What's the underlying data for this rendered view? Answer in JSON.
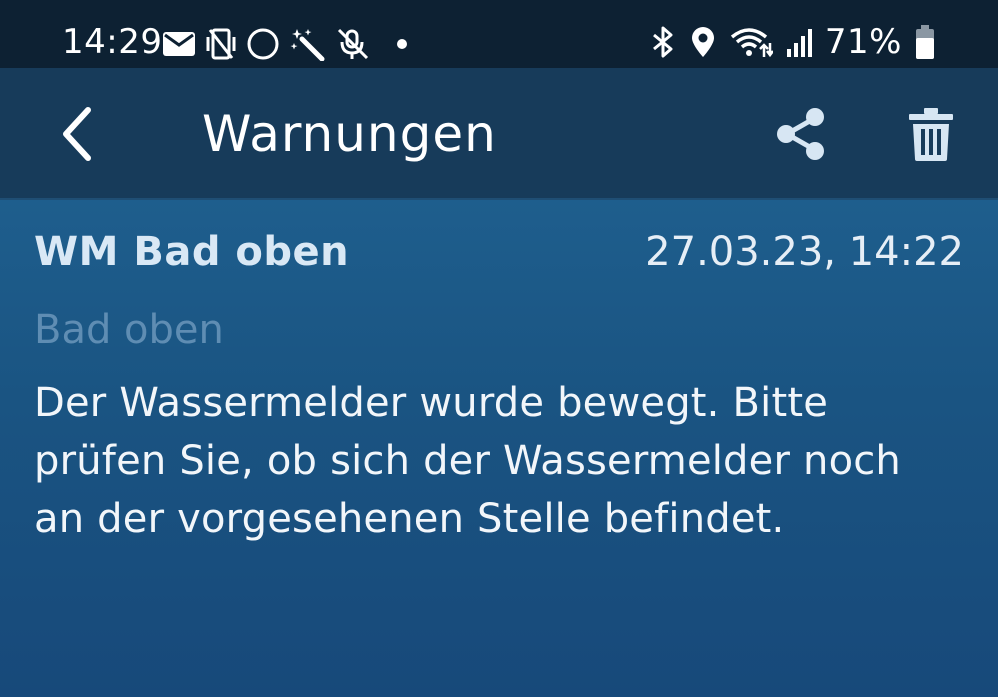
{
  "status_bar": {
    "time": "14:29",
    "left_icons": [
      "mail-icon",
      "vibrate-icon",
      "circle-icon",
      "magic-wand-icon",
      "mute-icon",
      "dot-icon"
    ],
    "right_icons": [
      "bluetooth-icon",
      "location-icon",
      "wifi-icon",
      "signal-icon",
      "battery-icon"
    ],
    "battery_percent": "71%",
    "battery_level": 0.71
  },
  "app_bar": {
    "title": "Warnungen",
    "back_icon": "chevron-left-icon",
    "share_icon": "share-icon",
    "delete_icon": "trash-icon"
  },
  "warning": {
    "device": "WM Bad oben",
    "timestamp": "27.03.23, 14:22",
    "room": "Bad oben",
    "message": "Der Wassermelder wurde bewegt. Bitte prüfen Sie, ob sich der Wassermelder noch an der vorgesehenen Stelle befindet."
  },
  "colors": {
    "status_bar_bg": "#0d2133",
    "app_bar_bg": "#173b5a",
    "content_bg": "#1e5e8d",
    "room_text": "#5f8db3"
  }
}
